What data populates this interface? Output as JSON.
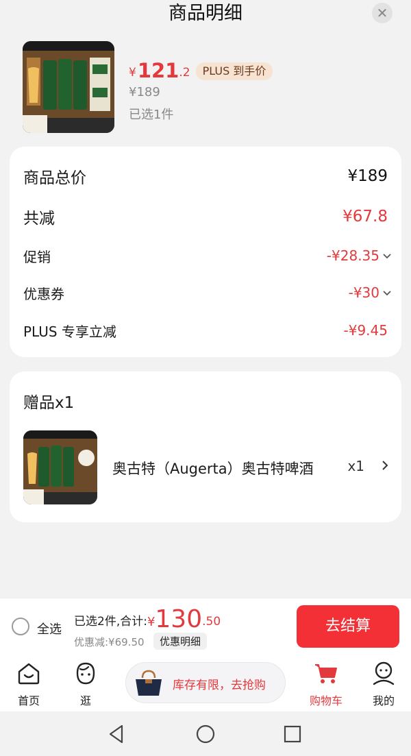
{
  "header": {
    "title": "商品明细"
  },
  "product": {
    "price_currency": "¥",
    "price_integer": "121",
    "price_decimal": ".2",
    "plus_badge": "PLUS 到手价",
    "original_price": "¥189",
    "selected_count": "已选1件"
  },
  "summary": {
    "rows": [
      {
        "label": "商品总价",
        "value": "¥189"
      },
      {
        "label": "共减",
        "value": "¥67.8"
      },
      {
        "label": "促销",
        "value": "-¥28.35"
      },
      {
        "label": "优惠券",
        "value": "-¥30"
      },
      {
        "label": "PLUS 专享立减",
        "value": "-¥9.45"
      }
    ]
  },
  "gift": {
    "title": "赠品x1",
    "name": "奥古特（Augerta）奥古特啤酒",
    "qty": "x1"
  },
  "checkout": {
    "select_all": "全选",
    "total_label": "已选2件,合计:",
    "total_currency": "¥",
    "total_integer": "130",
    "total_decimal": ".50",
    "discount": "优惠减:¥69.50",
    "detail_button": "优惠明细",
    "checkout_button": "去结算"
  },
  "tabbar": {
    "tabs": [
      {
        "label": "首页"
      },
      {
        "label": "逛"
      },
      {
        "label": "购物车"
      },
      {
        "label": "我的"
      }
    ],
    "promo_text": "库存有限，去抢购"
  },
  "colors": {
    "accent": "#e4393c",
    "checkout_bg": "#f23036",
    "plus_badge_bg": "#f7e3d1"
  }
}
